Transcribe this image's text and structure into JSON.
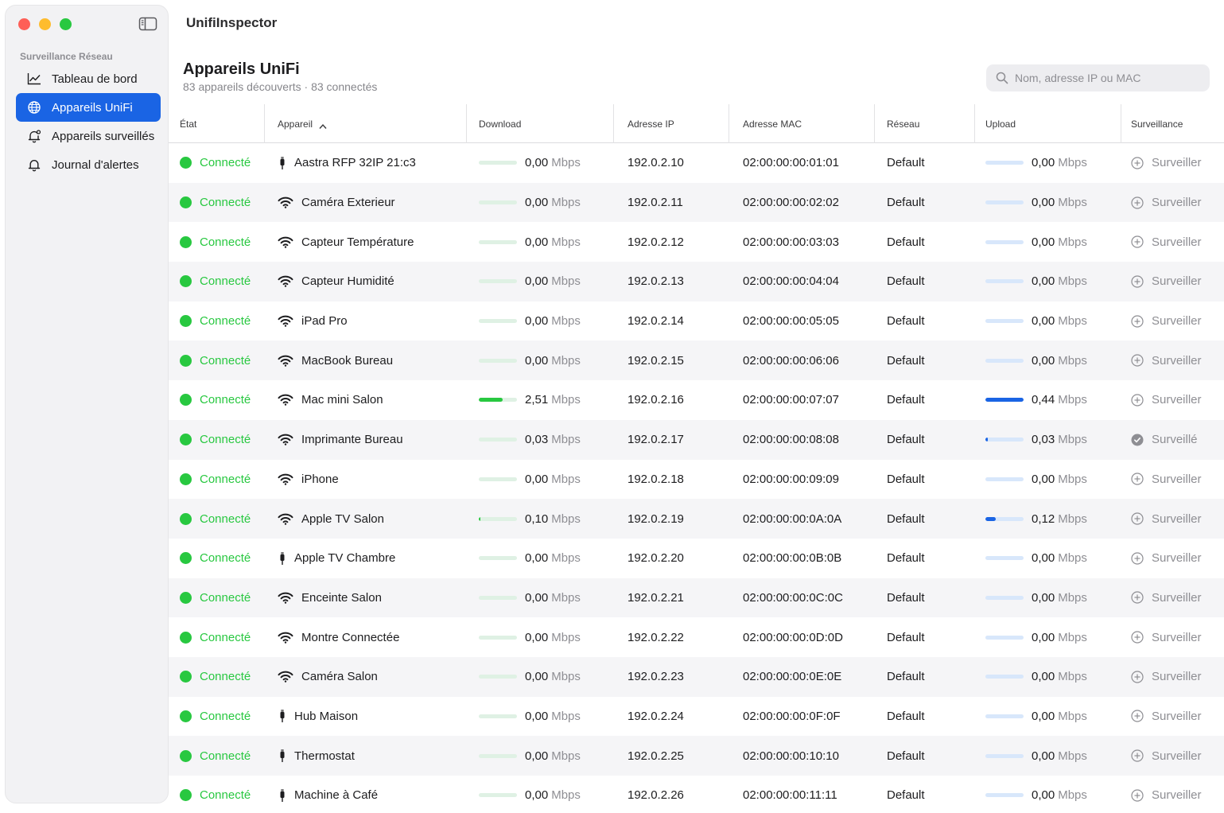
{
  "app": {
    "title": "UnifiInspector"
  },
  "sidebar": {
    "section_label": "Surveillance Réseau",
    "items": [
      {
        "label": "Tableau de bord",
        "icon": "chart-line-icon",
        "active": false
      },
      {
        "label": "Appareils UniFi",
        "icon": "globe-icon",
        "active": true
      },
      {
        "label": "Appareils surveillés",
        "icon": "bell-badge-icon",
        "active": false
      },
      {
        "label": "Journal d'alertes",
        "icon": "bell-icon",
        "active": false
      }
    ]
  },
  "header": {
    "title": "Appareils UniFi",
    "subtitle": "83 appareils découverts · 83 connectés"
  },
  "search": {
    "placeholder": "Nom, adresse IP ou MAC",
    "value": ""
  },
  "colors": {
    "accent": "#1a64e4",
    "connected": "#28c840"
  },
  "table": {
    "columns": [
      "État",
      "Appareil",
      "Download",
      "Adresse IP",
      "Adresse MAC",
      "Réseau",
      "Upload",
      "Surveillance"
    ],
    "sort_column": "Appareil",
    "sort_direction": "ascending",
    "unit": "Mbps",
    "rows": [
      {
        "status": "Connecté",
        "type": "wired",
        "name": "Aastra RFP 32IP 21:c3",
        "download": "0,00",
        "dl_level": 0,
        "ip": "192.0.2.10",
        "mac": "02:00:00:00:01:01",
        "network": "Default",
        "upload": "0,00",
        "ul_level": 0,
        "monitor": "Surveiller",
        "monitored": false
      },
      {
        "status": "Connecté",
        "type": "wifi",
        "name": "Caméra Exterieur",
        "download": "0,00",
        "dl_level": 0,
        "ip": "192.0.2.11",
        "mac": "02:00:00:00:02:02",
        "network": "Default",
        "upload": "0,00",
        "ul_level": 0,
        "monitor": "Surveiller",
        "monitored": false
      },
      {
        "status": "Connecté",
        "type": "wifi",
        "name": "Capteur Température",
        "download": "0,00",
        "dl_level": 0,
        "ip": "192.0.2.12",
        "mac": "02:00:00:00:03:03",
        "network": "Default",
        "upload": "0,00",
        "ul_level": 0,
        "monitor": "Surveiller",
        "monitored": false
      },
      {
        "status": "Connecté",
        "type": "wifi",
        "name": "Capteur Humidité",
        "download": "0,00",
        "dl_level": 0,
        "ip": "192.0.2.13",
        "mac": "02:00:00:00:04:04",
        "network": "Default",
        "upload": "0,00",
        "ul_level": 0,
        "monitor": "Surveiller",
        "monitored": false
      },
      {
        "status": "Connecté",
        "type": "wifi",
        "name": "iPad Pro",
        "download": "0,00",
        "dl_level": 0,
        "ip": "192.0.2.14",
        "mac": "02:00:00:00:05:05",
        "network": "Default",
        "upload": "0,00",
        "ul_level": 0,
        "monitor": "Surveiller",
        "monitored": false
      },
      {
        "status": "Connecté",
        "type": "wifi",
        "name": "MacBook Bureau",
        "download": "0,00",
        "dl_level": 0,
        "ip": "192.0.2.15",
        "mac": "02:00:00:00:06:06",
        "network": "Default",
        "upload": "0,00",
        "ul_level": 0,
        "monitor": "Surveiller",
        "monitored": false
      },
      {
        "status": "Connecté",
        "type": "wifi",
        "name": "Mac mini Salon",
        "download": "2,51",
        "dl_level": 0.62,
        "ip": "192.0.2.16",
        "mac": "02:00:00:00:07:07",
        "network": "Default",
        "upload": "0,44",
        "ul_level": 1.0,
        "monitor": "Surveiller",
        "monitored": false
      },
      {
        "status": "Connecté",
        "type": "wifi",
        "name": "Imprimante Bureau",
        "download": "0,03",
        "dl_level": 0,
        "ip": "192.0.2.17",
        "mac": "02:00:00:00:08:08",
        "network": "Default",
        "upload": "0,03",
        "ul_level": 0.06,
        "monitor": "Surveillé",
        "monitored": true
      },
      {
        "status": "Connecté",
        "type": "wifi",
        "name": "iPhone",
        "download": "0,00",
        "dl_level": 0,
        "ip": "192.0.2.18",
        "mac": "02:00:00:00:09:09",
        "network": "Default",
        "upload": "0,00",
        "ul_level": 0,
        "monitor": "Surveiller",
        "monitored": false
      },
      {
        "status": "Connecté",
        "type": "wifi",
        "name": "Apple TV Salon",
        "download": "0,10",
        "dl_level": 0.04,
        "ip": "192.0.2.19",
        "mac": "02:00:00:00:0A:0A",
        "network": "Default",
        "upload": "0,12",
        "ul_level": 0.28,
        "monitor": "Surveiller",
        "monitored": false
      },
      {
        "status": "Connecté",
        "type": "wired",
        "name": "Apple TV Chambre",
        "download": "0,00",
        "dl_level": 0,
        "ip": "192.0.2.20",
        "mac": "02:00:00:00:0B:0B",
        "network": "Default",
        "upload": "0,00",
        "ul_level": 0,
        "monitor": "Surveiller",
        "monitored": false
      },
      {
        "status": "Connecté",
        "type": "wifi",
        "name": "Enceinte Salon",
        "download": "0,00",
        "dl_level": 0,
        "ip": "192.0.2.21",
        "mac": "02:00:00:00:0C:0C",
        "network": "Default",
        "upload": "0,00",
        "ul_level": 0,
        "monitor": "Surveiller",
        "monitored": false
      },
      {
        "status": "Connecté",
        "type": "wifi",
        "name": "Montre Connectée",
        "download": "0,00",
        "dl_level": 0,
        "ip": "192.0.2.22",
        "mac": "02:00:00:00:0D:0D",
        "network": "Default",
        "upload": "0,00",
        "ul_level": 0,
        "monitor": "Surveiller",
        "monitored": false
      },
      {
        "status": "Connecté",
        "type": "wifi",
        "name": "Caméra Salon",
        "download": "0,00",
        "dl_level": 0,
        "ip": "192.0.2.23",
        "mac": "02:00:00:00:0E:0E",
        "network": "Default",
        "upload": "0,00",
        "ul_level": 0,
        "monitor": "Surveiller",
        "monitored": false
      },
      {
        "status": "Connecté",
        "type": "wired",
        "name": "Hub Maison",
        "download": "0,00",
        "dl_level": 0,
        "ip": "192.0.2.24",
        "mac": "02:00:00:00:0F:0F",
        "network": "Default",
        "upload": "0,00",
        "ul_level": 0,
        "monitor": "Surveiller",
        "monitored": false
      },
      {
        "status": "Connecté",
        "type": "wired",
        "name": "Thermostat",
        "download": "0,00",
        "dl_level": 0,
        "ip": "192.0.2.25",
        "mac": "02:00:00:00:10:10",
        "network": "Default",
        "upload": "0,00",
        "ul_level": 0,
        "monitor": "Surveiller",
        "monitored": false
      },
      {
        "status": "Connecté",
        "type": "wired",
        "name": "Machine à Café",
        "download": "0,00",
        "dl_level": 0,
        "ip": "192.0.2.26",
        "mac": "02:00:00:00:11:11",
        "network": "Default",
        "upload": "0,00",
        "ul_level": 0,
        "monitor": "Surveiller",
        "monitored": false
      }
    ]
  }
}
